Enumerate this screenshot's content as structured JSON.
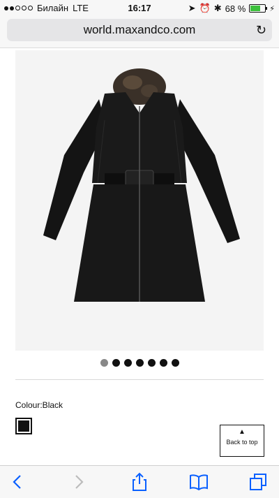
{
  "status": {
    "carrier": "Билайн",
    "network": "LTE",
    "time": "16:17",
    "battery": "68 %",
    "battery_level": 0.68
  },
  "browser": {
    "url": "world.maxandco.com"
  },
  "product": {
    "image_alt": "Black belted coat with fur collar",
    "carousel_count": 7,
    "active_index": 0
  },
  "details": {
    "colour_label": "Colour:Black",
    "swatch_color": "#111111",
    "back_to_top": "Back to top"
  },
  "colors": {
    "accent": "#0a60ff"
  }
}
